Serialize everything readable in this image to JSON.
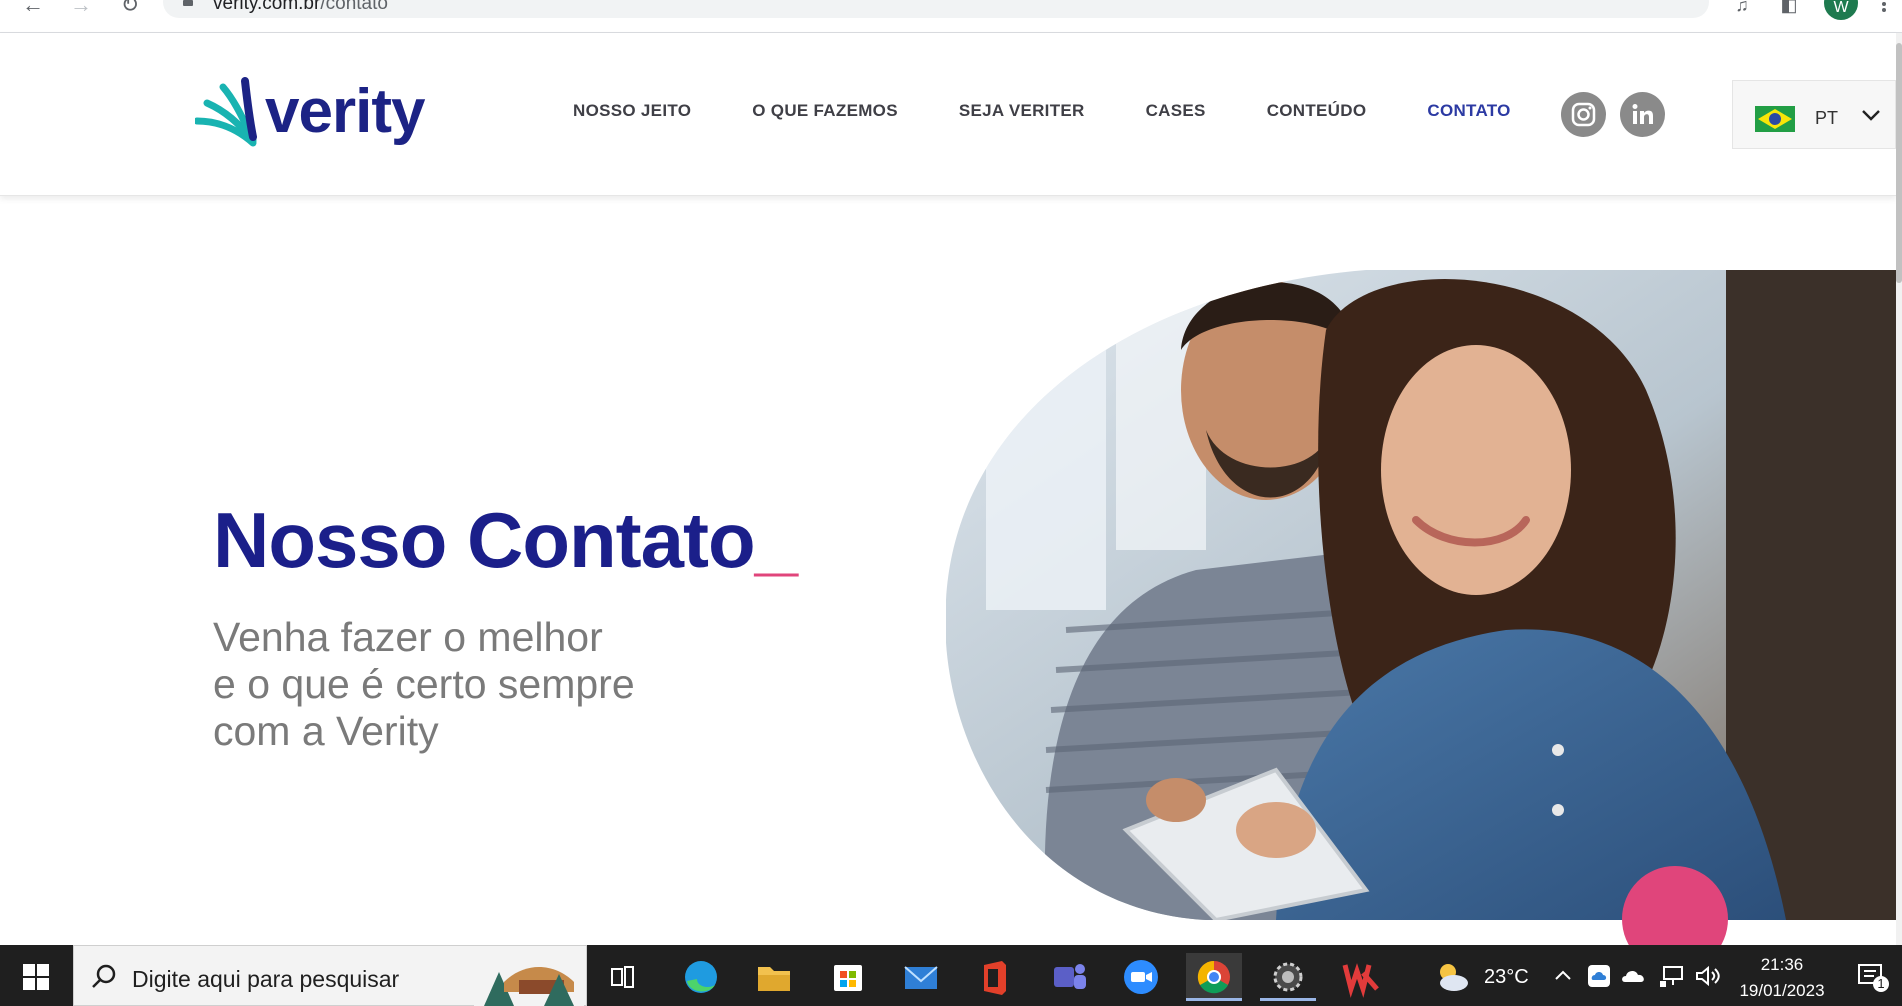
{
  "browser": {
    "url_host": "verity.com.br",
    "url_path": "/contato",
    "profile_initial": "W",
    "icons": [
      "back-arrow-icon",
      "forward-arrow-icon",
      "reload-icon",
      "lock-icon",
      "share-icon",
      "star-icon",
      "media-icon",
      "sidepanel-icon",
      "kebab-menu-icon"
    ]
  },
  "site": {
    "logo_text": "verity",
    "nav": [
      {
        "label": "NOSSO JEITO"
      },
      {
        "label": "O QUE FAZEMOS"
      },
      {
        "label": "SEJA VERITER"
      },
      {
        "label": "CASES"
      },
      {
        "label": "CONTEÚDO"
      },
      {
        "label": "CONTATO",
        "active": true
      }
    ],
    "social": [
      "instagram-icon",
      "linkedin-icon"
    ],
    "language": {
      "code": "PT",
      "flag": "brazil-flag-icon"
    },
    "colors": {
      "brand_blue": "#1b1f8a",
      "accent_pink": "#e0457b",
      "teal": "#19b3b1",
      "nav_text": "#3f3f46",
      "subtitle_gray": "#7a7a7a"
    }
  },
  "hero": {
    "title": "Nosso Contato",
    "title_cursor": "_",
    "subtitle_lines": [
      "Venha fazer o melhor",
      "e o que é certo sempre",
      "com a Verity"
    ],
    "photo": "couple-looking-at-tablet-photo"
  },
  "taskbar": {
    "search_placeholder": "Digite aqui para pesquisar",
    "apps": [
      "task-view-icon",
      "edge-icon",
      "file-explorer-icon",
      "microsoft-store-icon",
      "mail-icon",
      "office-icon",
      "teams-icon",
      "zoom-icon",
      "chrome-icon",
      "settings-gear-icon",
      "wps-office-icon"
    ],
    "weather": {
      "temp": "23°C",
      "icon": "partly-cloudy-icon"
    },
    "time": "21:36",
    "date": "19/01/2023",
    "notification_count": "1"
  }
}
